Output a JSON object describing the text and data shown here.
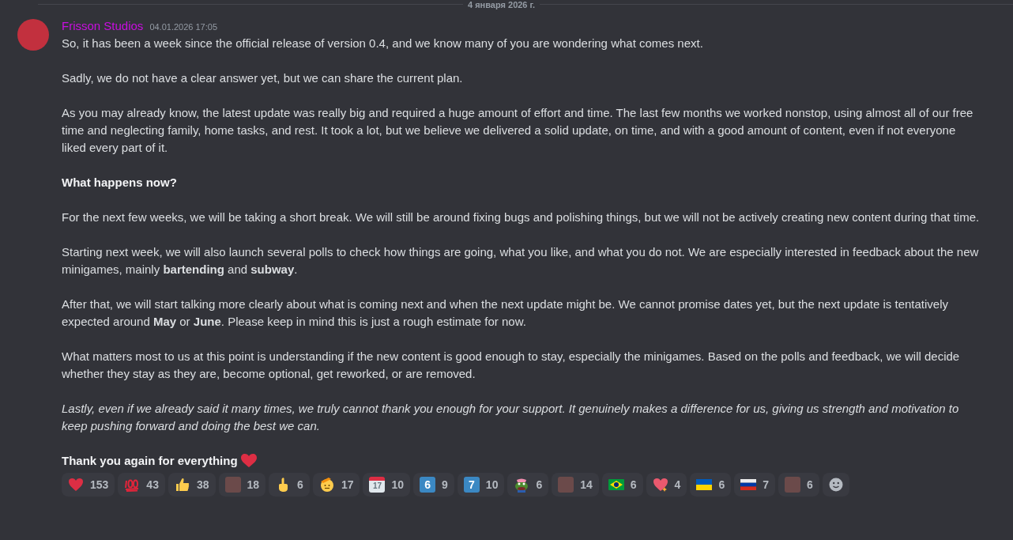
{
  "date_divider": "4 января 2026 г.",
  "message": {
    "author": "Frisson Studios",
    "timestamp": "04.01.2026 17:05",
    "paragraphs": [
      {
        "kind": "text",
        "text": "So, it has been a week since the official release of version 0.4, and we know many of you are wondering what comes next."
      },
      {
        "kind": "text",
        "text": "Sadly, we do not have a clear answer yet, but we can share the current plan."
      },
      {
        "kind": "text",
        "text": "As you may already know, the latest update was really big and required a huge amount of effort and time. The last few months we worked nonstop, using almost all of our free time and neglecting family, home tasks, and rest. It took a lot, but we believe we delivered a solid update, on time, and with a good amount of content, even if not everyone liked every part of it."
      },
      {
        "kind": "heading",
        "text": "What happens now?"
      },
      {
        "kind": "text",
        "text": "For the next few weeks, we will be taking a short break. We will still be around fixing bugs and polishing things, but we will not be actively creating new content during that time."
      },
      {
        "kind": "text",
        "text": "Starting next week, we will also launch several polls to check how things are going, what you like, and what you do not. We are especially interested in feedback about the new minigames, mainly **bartending** and **subway**."
      },
      {
        "kind": "text",
        "text": "After that, we will start talking more clearly about what is coming next and when the next update might be. We cannot promise dates yet, but the next update is tentatively expected around **May** or **June**. Please keep in mind this is just a rough estimate for now."
      },
      {
        "kind": "text",
        "text": "What matters most to us at this point is understanding if the new content is good enough to stay, especially the minigames. Based on the polls and feedback, we will decide whether they stay as they are, become optional, get reworked, or are removed."
      },
      {
        "kind": "italic",
        "text": "Lastly, even if we already said it many times, we truly cannot thank you enough for your support. It genuinely makes a difference for us, giving us strength and motivation to keep pushing forward and doing the best we can."
      },
      {
        "kind": "closing",
        "text": "Thank you again for everything"
      }
    ],
    "reactions": [
      {
        "kind": "heart",
        "count": "153"
      },
      {
        "kind": "hundred",
        "count": "43"
      },
      {
        "kind": "thumbs-up",
        "count": "38"
      },
      {
        "kind": "custom",
        "count": "18"
      },
      {
        "kind": "finger",
        "count": "6"
      },
      {
        "kind": "salute-face",
        "count": "17"
      },
      {
        "kind": "calendar",
        "label": "17",
        "count": "10"
      },
      {
        "kind": "keycap",
        "label": "6",
        "count": "9"
      },
      {
        "kind": "keycap",
        "label": "7",
        "count": "10"
      },
      {
        "kind": "frog",
        "count": "6"
      },
      {
        "kind": "custom",
        "count": "14"
      },
      {
        "kind": "flag-brazil",
        "count": "6"
      },
      {
        "kind": "sparkling-heart",
        "count": "4"
      },
      {
        "kind": "flag-ukraine",
        "count": "6"
      },
      {
        "kind": "flag-russia",
        "count": "7"
      },
      {
        "kind": "custom",
        "count": "6"
      }
    ]
  }
}
